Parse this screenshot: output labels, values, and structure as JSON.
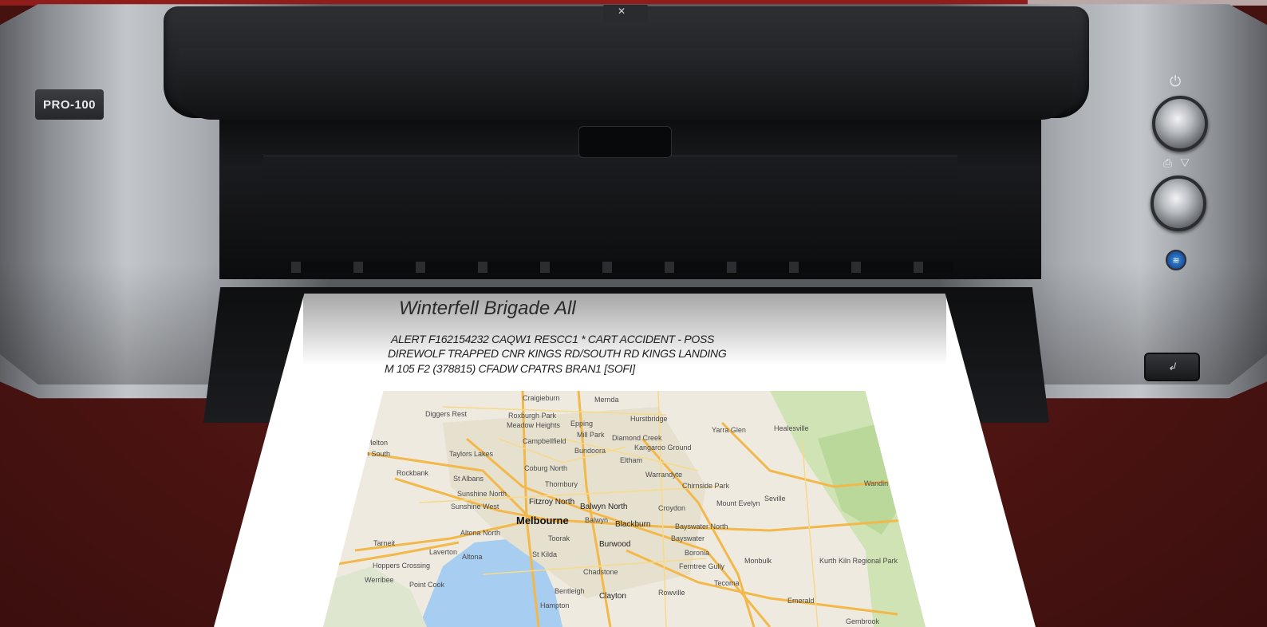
{
  "printer": {
    "model_label": "PRO-100",
    "brand_glyph": "✕",
    "resume_glyph": "⎙ ▽",
    "power_glyph": "⏻",
    "wifi_glyph": "((·))",
    "small_button_glyph": "↲"
  },
  "printout": {
    "title": "Winterfell Brigade All",
    "lines": [
      "ALERT F162154232 CAQW1 RESCC1 * CART ACCIDENT - POSS",
      "DIREWOLF TRAPPED CNR KINGS RD/SOUTH RD KINGS LANDING",
      "M 105 F2 (378815) CFADW CPATRS BRAN1 [SOFI]"
    ]
  },
  "map": {
    "labels": [
      {
        "text": "Melbourne",
        "cls": "big"
      },
      {
        "text": "Craigieburn",
        "cls": ""
      },
      {
        "text": "Mernda",
        "cls": ""
      },
      {
        "text": "Diggers Rest",
        "cls": ""
      },
      {
        "text": "Roxburgh Park",
        "cls": ""
      },
      {
        "text": "Meadow Heights",
        "cls": ""
      },
      {
        "text": "Epping",
        "cls": ""
      },
      {
        "text": "Hurstbridge",
        "cls": ""
      },
      {
        "text": "Melton",
        "cls": ""
      },
      {
        "text": "Campbellfield",
        "cls": ""
      },
      {
        "text": "Mill Park",
        "cls": ""
      },
      {
        "text": "Diamond Creek",
        "cls": ""
      },
      {
        "text": "Yarra Glen",
        "cls": ""
      },
      {
        "text": "Healesville",
        "cls": ""
      },
      {
        "text": "on South",
        "cls": ""
      },
      {
        "text": "Taylors Lakes",
        "cls": ""
      },
      {
        "text": "Bundoora",
        "cls": ""
      },
      {
        "text": "Kangaroo Ground",
        "cls": ""
      },
      {
        "text": "Eltham",
        "cls": ""
      },
      {
        "text": "Coburg North",
        "cls": ""
      },
      {
        "text": "Rockbank",
        "cls": ""
      },
      {
        "text": "St Albans",
        "cls": ""
      },
      {
        "text": "Warrandyte",
        "cls": ""
      },
      {
        "text": "Thornbury",
        "cls": ""
      },
      {
        "text": "Sunshine North",
        "cls": ""
      },
      {
        "text": "Chirnside Park",
        "cls": ""
      },
      {
        "text": "Sunshine West",
        "cls": ""
      },
      {
        "text": "Fitzroy North",
        "cls": ""
      },
      {
        "text": "Balwyn North",
        "cls": ""
      },
      {
        "text": "Croydon",
        "cls": ""
      },
      {
        "text": "Mount Evelyn",
        "cls": ""
      },
      {
        "text": "Seville",
        "cls": ""
      },
      {
        "text": "Wandin",
        "cls": ""
      },
      {
        "text": "Balwyn",
        "cls": ""
      },
      {
        "text": "Blackburn",
        "cls": ""
      },
      {
        "text": "Altona North",
        "cls": ""
      },
      {
        "text": "Toorak",
        "cls": ""
      },
      {
        "text": "Bayswater North",
        "cls": ""
      },
      {
        "text": "Bayswater",
        "cls": ""
      },
      {
        "text": "Tarneit",
        "cls": ""
      },
      {
        "text": "Burwood",
        "cls": ""
      },
      {
        "text": "Boronia",
        "cls": ""
      },
      {
        "text": "Laverton",
        "cls": ""
      },
      {
        "text": "Altona",
        "cls": ""
      },
      {
        "text": "St Kilda",
        "cls": ""
      },
      {
        "text": "Monbulk",
        "cls": ""
      },
      {
        "text": "Kurth Kiln Regional Park",
        "cls": ""
      },
      {
        "text": "Hoppers Crossing",
        "cls": ""
      },
      {
        "text": "Ferntree Gully",
        "cls": ""
      },
      {
        "text": "Werribee",
        "cls": ""
      },
      {
        "text": "Point Cook",
        "cls": ""
      },
      {
        "text": "Chadstone",
        "cls": ""
      },
      {
        "text": "Tecoma",
        "cls": ""
      },
      {
        "text": "Bentleigh",
        "cls": ""
      },
      {
        "text": "Clayton",
        "cls": ""
      },
      {
        "text": "Rowville",
        "cls": ""
      },
      {
        "text": "Emerald",
        "cls": ""
      },
      {
        "text": "Hampton",
        "cls": ""
      },
      {
        "text": "Gembrook",
        "cls": ""
      }
    ]
  }
}
